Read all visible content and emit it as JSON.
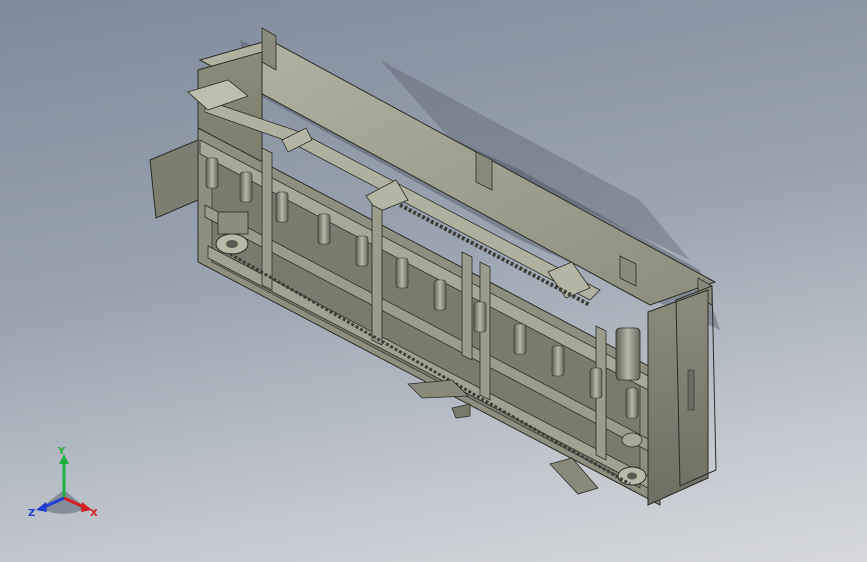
{
  "viewport": {
    "colors": {
      "bg_top": "#7f8b9c",
      "bg_bottom": "#d6d8dc",
      "metal": "#9a9a8a",
      "metal_dark": "#6d6d60",
      "edge": "#2c2c26"
    }
  },
  "model": {
    "icon": "conveyor-frame-assembly-3d"
  },
  "triad": {
    "x_label": "X",
    "y_label": "Y",
    "z_label": "Z",
    "colors": {
      "x": "#d02020",
      "y": "#20b040",
      "z": "#2040d0"
    }
  }
}
